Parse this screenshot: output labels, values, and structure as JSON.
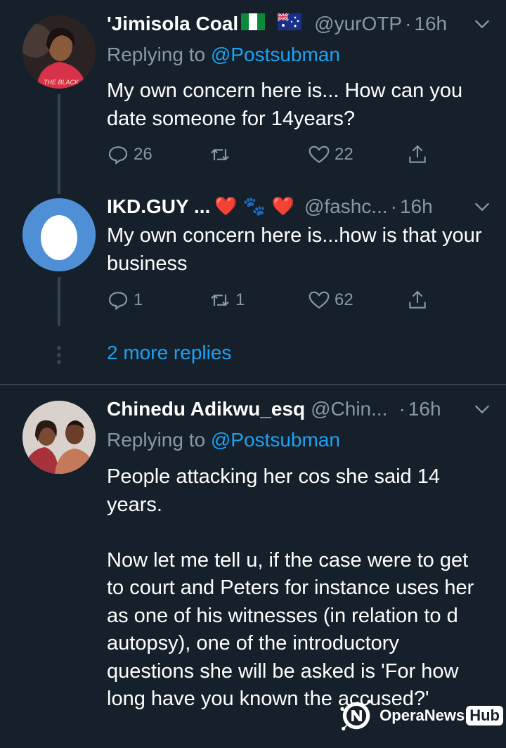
{
  "tweets": [
    {
      "name": "'Jimisola Coal",
      "handle": "@yurOTP",
      "dot": "·",
      "time": "16h",
      "replying_prefix": "Replying to ",
      "replying_to": "@Postsubman",
      "text": "My own concern here is... How can you date someone for 14years?",
      "replies": "26",
      "retweets": "",
      "likes": "22",
      "avatar_text": "THE BLACK"
    },
    {
      "name": "IKD.GUY ...",
      "emoji": "❤️ 🐾 ❤️",
      "handle": "@fashc...",
      "dot": "·",
      "time": "16h",
      "text": "My own concern here is...how is that your business",
      "replies": "1",
      "retweets": "1",
      "likes": "62"
    },
    {
      "name": "Chinedu Adikwu_esq",
      "handle": "@Chin...",
      "dot": "·",
      "time": "16h",
      "replying_prefix": "Replying to ",
      "replying_to": "@Postsubman",
      "text": "People attacking her cos she said 14 years.\n\nNow let me tell u, if the case were to get to court and Peters for instance uses her as one of his witnesses (in relation to d autopsy), one of the introductory questions she will be asked is 'For how long have you known the accused?'"
    }
  ],
  "more_replies": "2 more replies",
  "watermark": {
    "brand": "OperaNews",
    "suffix": "Hub"
  },
  "colors": {
    "background": "#15202b",
    "accent": "#1da1f2",
    "muted": "#8899a6",
    "like": "#e0245e"
  }
}
